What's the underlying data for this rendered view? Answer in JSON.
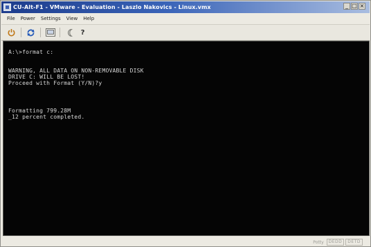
{
  "window": {
    "title": "CU-Alt-F1 - VMware - Evaluation - Laszlo Nakovics - Linux.vmx",
    "controls": [
      "_",
      "□",
      "×"
    ]
  },
  "menubar": {
    "items": [
      "File",
      "Power",
      "Settings",
      "View",
      "Help"
    ]
  },
  "toolbar": {
    "buttons": [
      {
        "icon": "power-icon"
      },
      {
        "icon": "reset-icon"
      },
      {
        "icon": "fullscreen-icon"
      },
      {
        "icon": "suspend-icon"
      },
      {
        "icon": "help-icon",
        "label": "?"
      }
    ]
  },
  "console": {
    "lines": [
      "A:\\>format c:",
      "",
      "WARNING, ALL DATA ON NON-REMOVABLE DISK",
      "DRIVE C: WILL BE LOST!",
      "Proceed with Format (Y/N)?y",
      "",
      "",
      "Formatting 799.28M",
      "_12 percent completed."
    ]
  },
  "statusbar": {
    "text": "Potty",
    "indicators": [
      "DEDD",
      "DETD"
    ]
  },
  "colors": {
    "titlebar_start": "#1d3c8c",
    "titlebar_end": "#a9bde0",
    "console_bg": "#050505",
    "console_fg": "#d8d8d8"
  }
}
